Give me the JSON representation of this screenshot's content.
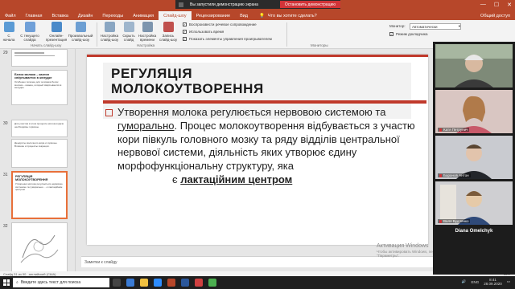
{
  "titlebar": {
    "demo_message": "Вы запустили демонстрацию экрана",
    "stop_label": "Остановить демонстрацию",
    "minimize": "—",
    "maximize": "☐",
    "close": "✕"
  },
  "tabs": [
    "Файл",
    "Главная",
    "Вставка",
    "Дизайн",
    "Переходы",
    "Анимация",
    "Слайд-шоу",
    "Рецензирование",
    "Вид"
  ],
  "active_tab": "Слайд-шоу",
  "tell_me": "Что вы хотите сделать?",
  "share": "Общий доступ",
  "ribbon": {
    "start_group": {
      "items": [
        "С начала",
        "С текущего слайда",
        "Онлайн-презентация",
        "Произвольный слайд-шоу"
      ],
      "label": "Начать слайд-шоу"
    },
    "setup_group": {
      "items": [
        "Настройка слайд-шоу",
        "Скрыть слайд",
        "Настройка времени",
        "Запись слайд-шоу"
      ],
      "label": "Настройка"
    },
    "checks": [
      {
        "label": "Воспроизвести речевое сопровождение",
        "checked": true
      },
      {
        "label": "Использовать время",
        "checked": true
      },
      {
        "label": "Показать элементы управления проигрывателем",
        "checked": true
      }
    ],
    "monitor_label": "Монитор:",
    "monitor_value": "Автоматически",
    "presenter_view": "Режим докладчика",
    "monitors_group_label": "Мониторы"
  },
  "thumbnails": [
    {
      "num": "29",
      "title": "",
      "text": ""
    },
    {
      "num": "",
      "title": "Белок молока – казеин свёртывается в желудке",
      "text": "Особенно полезен для человека белок молока – казеин, который свёртывается в желудке."
    },
    {
      "num": "30",
      "title": "",
      "text": "Для участия в этом процессе молокоотдачи необходимы гормоны."
    },
    {
      "num": "",
      "title": "",
      "text": "Дендриты молочного жира и гормоны. Влияние и процессы секреции."
    },
    {
      "num": "31",
      "title": "РЕГУЛЯЦІЯ МОЛОКОУТВОРЕННЯ",
      "text": "Утворення молока регулюється нервовою системою та гуморально. ...є лактаційним центром"
    },
    {
      "num": "32",
      "title": "",
      "text": ""
    }
  ],
  "slide": {
    "title_line1": "РЕГУЛЯЦІЯ",
    "title_line2": "МОЛОКОУТВОРЕННЯ",
    "body_part1": "Утворення молока регулюється нервовою системою та ",
    "body_underlined": "гуморально",
    "body_part2": ". Процес молокоутворення відбувається з участю кори півкуль головного мозку та ряду відділів центральної нервової системи, діяльність яких  утворює єдину морфофункціональну структуру, яка",
    "body_prefix": "є ",
    "body_bold": "лактаційним центром"
  },
  "notes_placeholder": "Заметки к слайду",
  "watermark": {
    "line1": "Активация Windows",
    "line2": "Чтобы активировать Windows, перейдите в раздел",
    "line3": "\"Параметры\"."
  },
  "status": {
    "slide_info": "Слайд 31 из 90",
    "language": "английский (США)",
    "zoom": "66%"
  },
  "taskbar": {
    "search_placeholder": "Введите здесь текст для поиска",
    "lang": "ENG",
    "time": "8:41",
    "date": "28.09.2020"
  },
  "participants": [
    {
      "name": ""
    },
    {
      "name": "Катя Петрунич"
    },
    {
      "name": "Баранов Антон"
    },
    {
      "name": "Валя Будлянко"
    }
  ],
  "speaker_name": "Diana Omelchyk"
}
